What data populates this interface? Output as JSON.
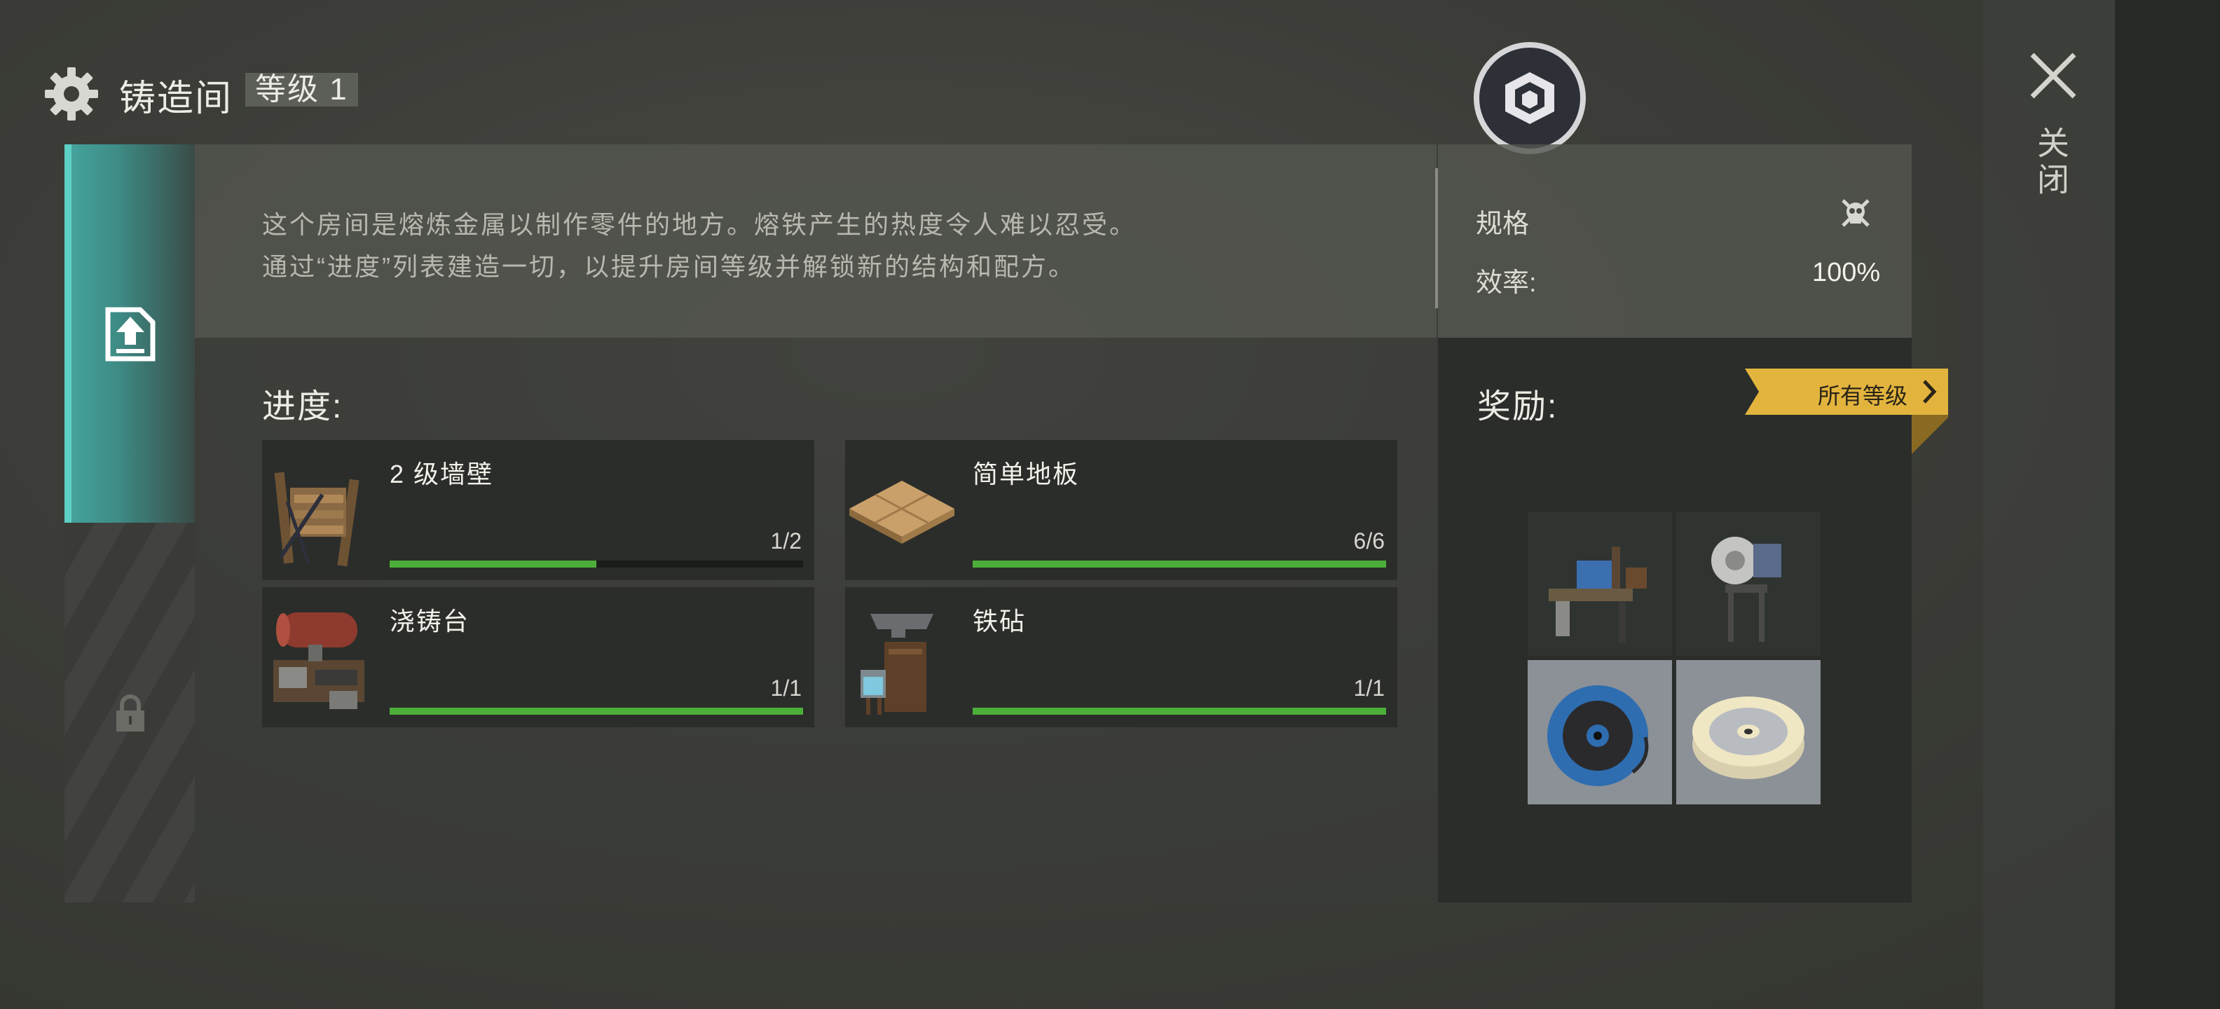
{
  "header": {
    "title": "铸造间",
    "level_badge": "等级 1"
  },
  "close": {
    "label": "关闭"
  },
  "description": {
    "line1": "这个房间是熔炼金属以制作零件的地方。熔铁产生的热度令人难以忍受。",
    "line2": "通过“进度”列表建造一切，以提升房间等级并解锁新的结构和配方。"
  },
  "specs": {
    "title": "规格",
    "efficiency_label": "效率:",
    "efficiency_value": "100%"
  },
  "progress": {
    "label": "进度:",
    "items": [
      {
        "name": "2 级墙壁",
        "count": "1/2",
        "current": 1,
        "total": 2,
        "icon": "wall-icon"
      },
      {
        "name": "简单地板",
        "count": "6/6",
        "current": 6,
        "total": 6,
        "icon": "floor-icon"
      },
      {
        "name": "浇铸台",
        "count": "1/1",
        "current": 1,
        "total": 1,
        "icon": "casting-table-icon"
      },
      {
        "name": "铁砧",
        "count": "1/1",
        "current": 1,
        "total": 1,
        "icon": "anvil-icon"
      }
    ]
  },
  "rewards": {
    "label": "奖励:",
    "all_levels_button": "所有等级",
    "items": [
      "workbench-icon",
      "grinder-icon",
      "blue-wire-spool-icon",
      "steel-wire-spool-icon"
    ]
  },
  "colors": {
    "accent_teal": "#45a6a0",
    "progress_green": "#4caf3a",
    "ribbon_gold": "#e2b43e"
  }
}
